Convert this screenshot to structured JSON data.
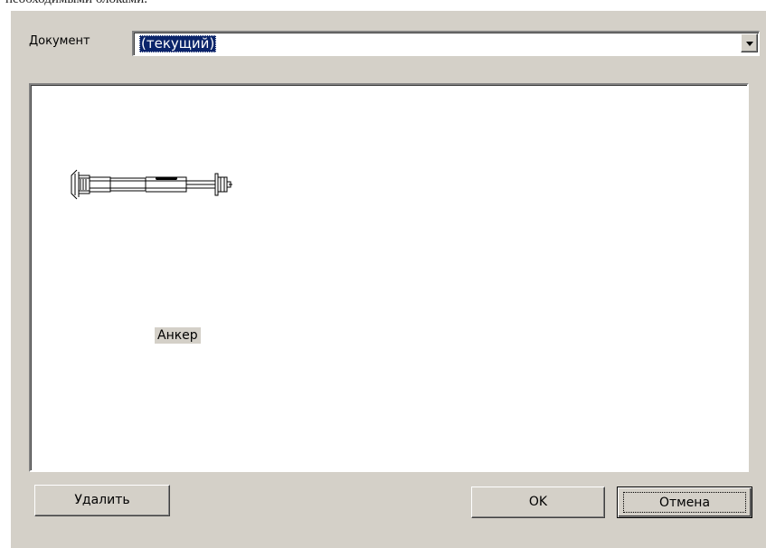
{
  "page_text_fragment": "необходимыми блоками.",
  "dialog": {
    "document_label_hotkey": "Д",
    "document_label_rest": "окумент",
    "document_combo": {
      "value": "(текущий)",
      "dropdown_icon": "chevron-down-icon"
    },
    "blocks": [
      {
        "label": "Анкер",
        "icon": "anchor-bolt-drawing"
      }
    ],
    "buttons": {
      "delete": "Удалить",
      "ok": "OK",
      "cancel": "Отмена"
    },
    "colors": {
      "dialog_bg": "#d4d0c8",
      "selection_bg": "#0a246a",
      "selection_text": "#ffffff"
    }
  }
}
